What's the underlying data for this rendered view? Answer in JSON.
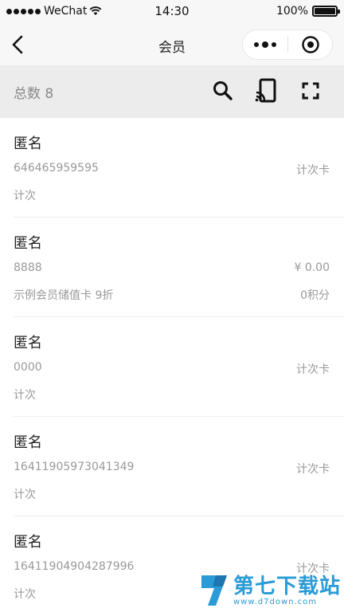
{
  "statusbar": {
    "carrier": "WeChat",
    "time": "14:30",
    "battery": "100%",
    "battery_level": 1.0
  },
  "navbar": {
    "title": "会员"
  },
  "toolbar": {
    "total": "总数 8"
  },
  "members": [
    {
      "name": "匿名",
      "card_no": "646465959595",
      "right_top": "计次卡",
      "card_type": "计次",
      "right_bottom": ""
    },
    {
      "name": "匿名",
      "card_no": "8888",
      "right_top": "¥ 0.00",
      "card_type": "示例会员储值卡 9折",
      "right_bottom": "0积分"
    },
    {
      "name": "匿名",
      "card_no": "0000",
      "right_top": "计次卡",
      "card_type": "计次",
      "right_bottom": ""
    },
    {
      "name": "匿名",
      "card_no": "16411905973041349",
      "right_top": "计次卡",
      "card_type": "计次",
      "right_bottom": ""
    },
    {
      "name": "匿名",
      "card_no": "16411904904287996",
      "right_top": "计次卡",
      "card_type": "计次",
      "right_bottom": ""
    }
  ],
  "watermark": {
    "title": "第七下载站",
    "url": "www.d7down.com"
  },
  "colors": {
    "toolbar_bg": "#ececec",
    "navbar_bg": "#f7f7f7",
    "watermark": "#2a9bd6"
  }
}
